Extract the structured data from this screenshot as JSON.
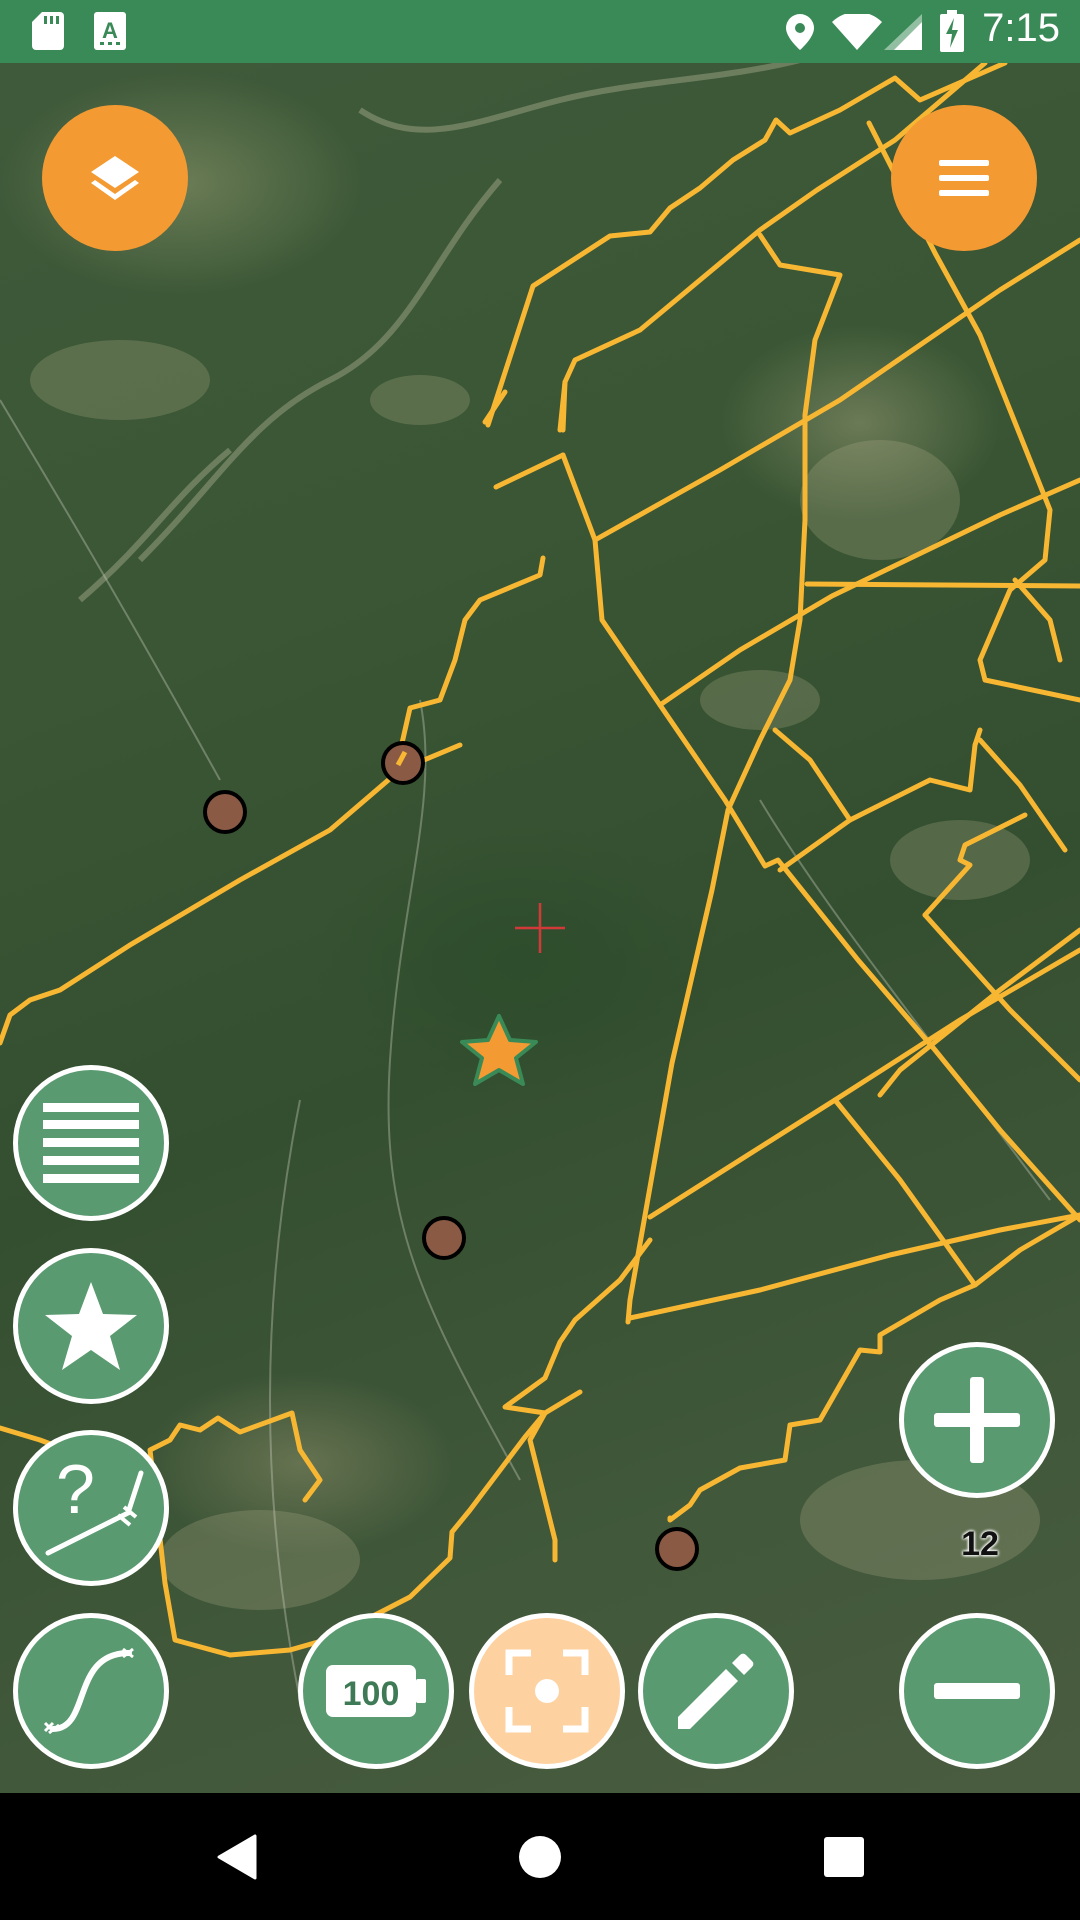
{
  "status_bar": {
    "time": "7:15",
    "left_icons": [
      "sd-card-icon",
      "text-a-icon"
    ],
    "right_icons": [
      "location-pin-icon",
      "wifi-icon",
      "signal-icon",
      "battery-charging-icon"
    ]
  },
  "map": {
    "type": "satellite",
    "center_marker": "crosshair-icon",
    "favorite_marker": "star-icon"
  },
  "buttons": {
    "layers": "layers-icon",
    "menu": "hamburger-menu-icon",
    "list": "list-icon",
    "favorites": "star-icon",
    "measure": "measure-question-icon",
    "track": "track-curve-icon",
    "battery_level": "100",
    "center_location": "center-focus-icon",
    "edit": "pencil-icon",
    "zoom_in": "plus-icon",
    "zoom_out": "minus-icon"
  },
  "zoom_level": "12",
  "colors": {
    "status_bar": "#3a8a57",
    "fab_orange": "#f49a33",
    "fab_green": "#5a9a70",
    "fab_peach": "#fdd2a0",
    "track_line": "#f7b733"
  },
  "nav_bar": {
    "back": "back-triangle-icon",
    "home": "home-circle-icon",
    "recents": "recents-square-icon"
  }
}
